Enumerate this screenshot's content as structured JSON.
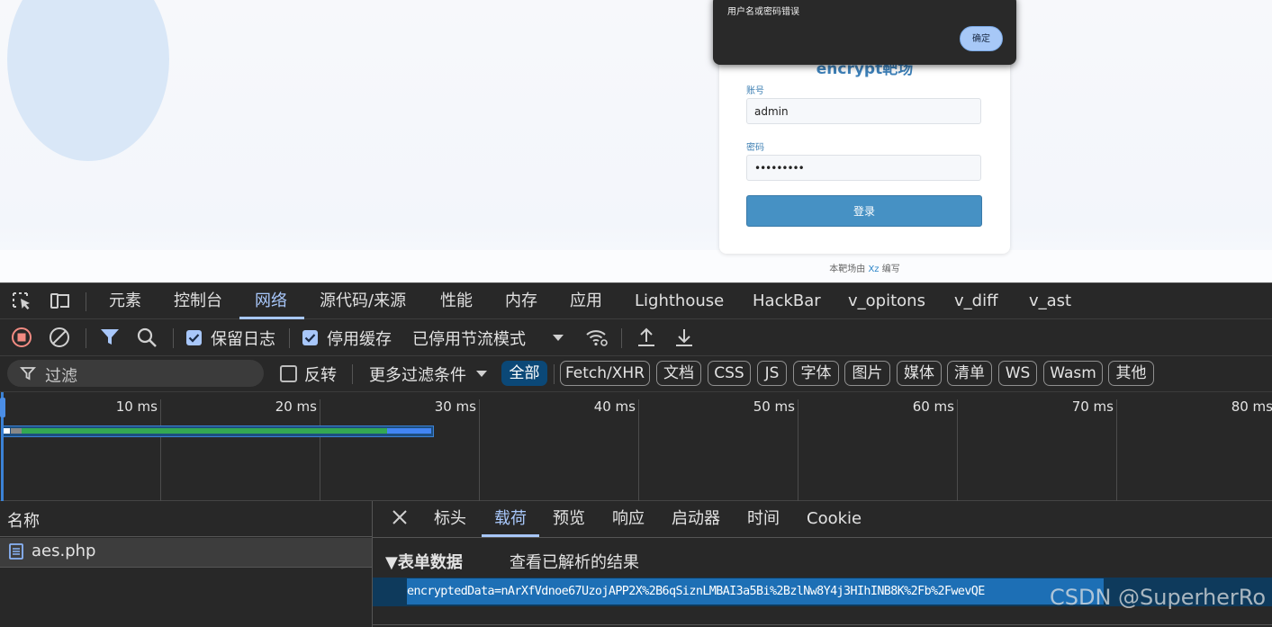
{
  "page": {
    "alert": {
      "message": "用户名或密码错误",
      "ok_label": "确定"
    },
    "login": {
      "title": "encrypt靶场",
      "username_label": "账号",
      "username_value": "admin",
      "password_label": "密码",
      "password_value": "•••••••••",
      "submit_label": "登录"
    },
    "footer": {
      "prefix": "本靶场由 ",
      "author": "Xz",
      "suffix": " 编写"
    }
  },
  "devtools": {
    "tabs": [
      "元素",
      "控制台",
      "网络",
      "源代码/来源",
      "性能",
      "内存",
      "应用",
      "Lighthouse",
      "HackBar",
      "v_opitons",
      "v_diff",
      "v_ast"
    ],
    "active_tab": "网络",
    "toolbar": {
      "preserve_log": "保留日志",
      "disable_cache": "停用缓存",
      "throttling": "已停用节流模式"
    },
    "filter": {
      "placeholder": "过滤",
      "invert": "反转",
      "more_filters": "更多过滤条件",
      "types": [
        "全部",
        "Fetch/XHR",
        "文档",
        "CSS",
        "JS",
        "字体",
        "图片",
        "媒体",
        "清单",
        "WS",
        "Wasm",
        "其他"
      ],
      "active_type": "全部"
    },
    "timeline": {
      "ticks": [
        "10 ms",
        "20 ms",
        "30 ms",
        "40 ms",
        "50 ms",
        "60 ms",
        "70 ms",
        "80 ms"
      ]
    },
    "requests": {
      "column_name": "名称",
      "items": [
        "aes.php"
      ]
    },
    "detail": {
      "tabs": [
        "标头",
        "载荷",
        "预览",
        "响应",
        "启动器",
        "时间",
        "Cookie"
      ],
      "active_tab": "载荷",
      "section_title": "▼表单数据",
      "view_parsed": "查看已解析的结果",
      "payload": "encryptedData=nArXfVdnoe67UzojAPP2X%2B6qSiznLMBAI3a5Bi%2BzlNw8Y4j3HIhINB8K%2Fb%2FwevQE"
    }
  },
  "watermark": "CSDN @SuperherRo"
}
